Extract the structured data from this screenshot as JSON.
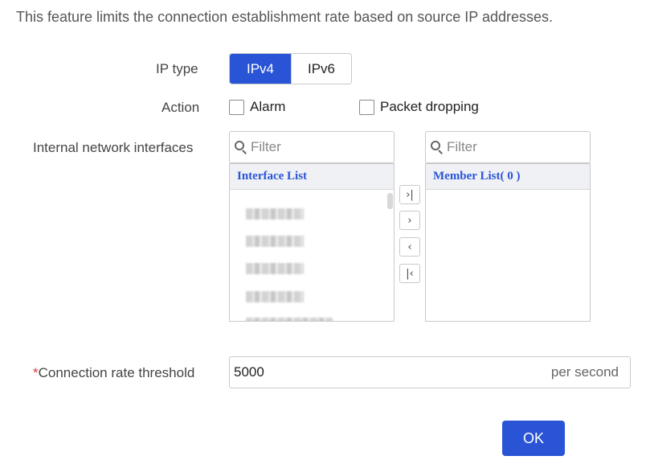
{
  "description": "This feature limits the connection establishment rate based on source IP addresses.",
  "ip_type": {
    "label": "IP type",
    "options": [
      "IPv4",
      "IPv6"
    ],
    "selected": "IPv4"
  },
  "action": {
    "label": "Action",
    "alarm_label": "Alarm",
    "alarm_checked": false,
    "drop_label": "Packet dropping",
    "drop_checked": false
  },
  "interfaces": {
    "label": "Internal network interfaces",
    "left_filter_placeholder": "Filter",
    "right_filter_placeholder": "Filter",
    "left_list_header": "Interface List",
    "right_list_header": "Member List( 0 )",
    "transfer_buttons": [
      "add-all",
      "add",
      "remove",
      "remove-all"
    ],
    "transfer_glyphs": [
      "›|",
      "›",
      "‹",
      "|‹"
    ]
  },
  "threshold": {
    "required_mark": "*",
    "label": "Connection rate threshold",
    "value": "5000",
    "unit": "per second"
  },
  "ok_label": "OK",
  "colors": {
    "primary": "#2a54d6",
    "required": "#e0393e"
  }
}
